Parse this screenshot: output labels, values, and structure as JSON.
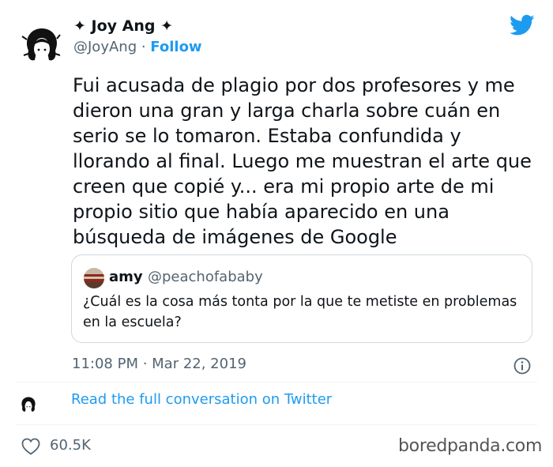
{
  "author": {
    "name": "✦ Joy Ang ✦",
    "handle": "@JoyAng",
    "separator": " · ",
    "follow_label": "Follow"
  },
  "tweet": {
    "text": "Fui acusada de plagio por dos profesores y me\ndieron una gran y larga charla sobre cuán en\nserio se lo tomaron. Estaba confundida y\nllorando al final. Luego me muestran el arte que\ncreen que copié y... era mi propio arte de mi\npropio sitio que había aparecido en una\nbúsqueda de imágenes de Google",
    "timestamp": "11:08 PM · Mar 22, 2019"
  },
  "quote": {
    "name": "amy",
    "handle": "@peachofababy",
    "text": "¿Cuál es la cosa más tonta por la que te metiste en problemas\nen la escuela?"
  },
  "conversation_link": "Read the full conversation on Twitter",
  "likes": {
    "count": "60.5K"
  },
  "watermark": "boredpanda.com",
  "colors": {
    "accent": "#1d9bf0",
    "secondary_text": "#536471",
    "border": "#cfd9de"
  },
  "icons": [
    "twitter-bird-icon",
    "info-icon",
    "heart-icon"
  ]
}
